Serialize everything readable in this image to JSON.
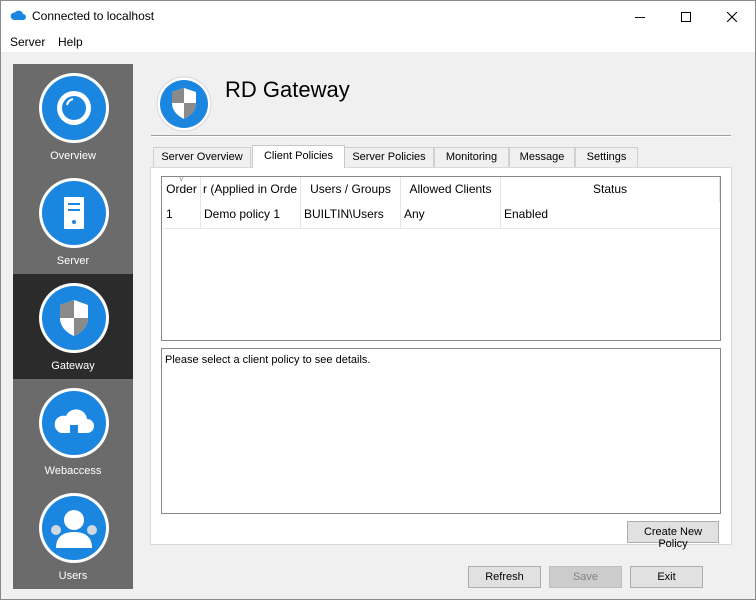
{
  "window": {
    "title": "Connected to localhost"
  },
  "menu": {
    "items": [
      "Server",
      "Help"
    ]
  },
  "sidebar": {
    "items": [
      {
        "label": "Overview",
        "icon": "overview-icon"
      },
      {
        "label": "Server",
        "icon": "server-icon"
      },
      {
        "label": "Gateway",
        "icon": "gateway-shield-icon",
        "active": true
      },
      {
        "label": "Webaccess",
        "icon": "cloud-icon"
      },
      {
        "label": "Users",
        "icon": "users-icon"
      }
    ]
  },
  "header": {
    "title": "RD Gateway"
  },
  "tabs": [
    {
      "label": "Server Overview"
    },
    {
      "label": "Client Policies",
      "active": true
    },
    {
      "label": "Server Policies"
    },
    {
      "label": "Monitoring"
    },
    {
      "label": "Message"
    },
    {
      "label": "Settings"
    }
  ],
  "policies": {
    "columns": [
      "Order",
      "r (Applied in Orde",
      "Users / Groups",
      "Allowed Clients",
      "Status"
    ],
    "rows": [
      {
        "order": "1",
        "name": "Demo policy 1",
        "users": "BUILTIN\\Users",
        "clients": "Any",
        "status": "Enabled"
      }
    ]
  },
  "details": {
    "text": "Please select a client policy to see details."
  },
  "buttons": {
    "create": "Create New Policy",
    "refresh": "Refresh",
    "save": "Save",
    "exit": "Exit"
  },
  "colors": {
    "accent": "#1a86e0",
    "sidebar": "#6b6b6b",
    "sidebar_active": "#2b2b2b"
  }
}
